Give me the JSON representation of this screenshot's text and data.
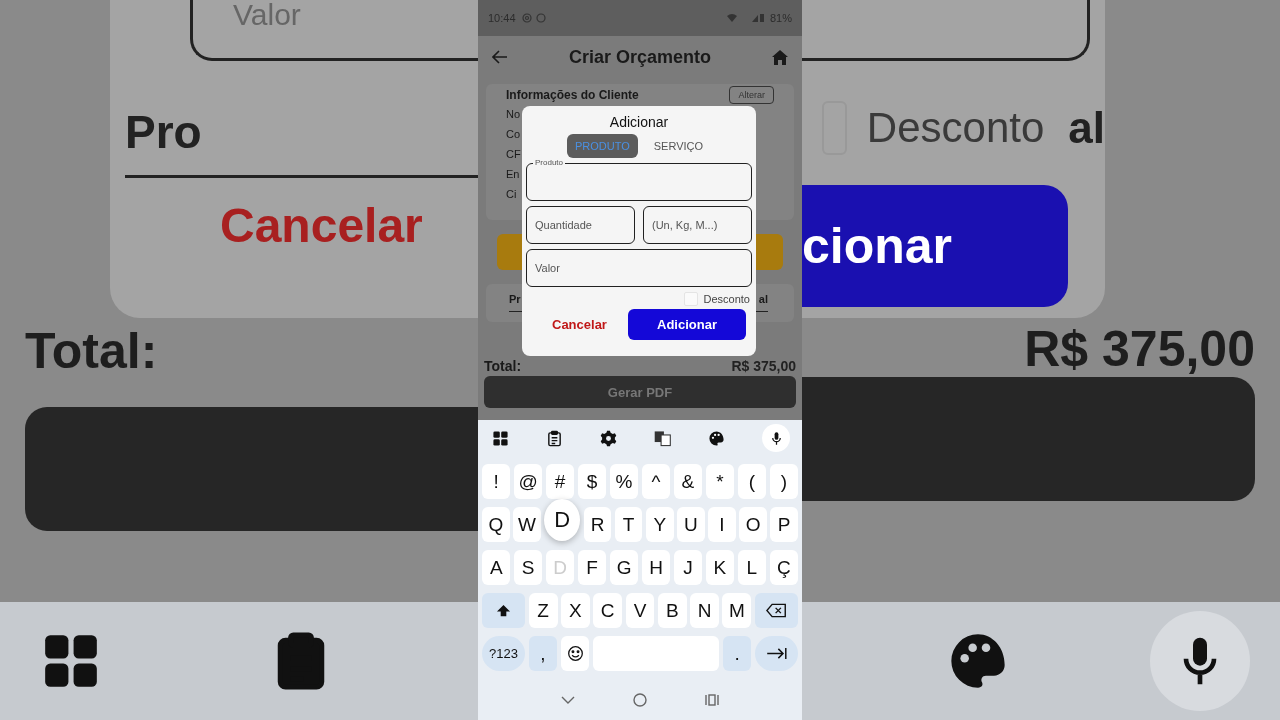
{
  "backdrop": {
    "left": {
      "field_text": "Valor",
      "label": "Pro",
      "cancel": "Cancelar",
      "total_label": "Total:"
    },
    "right": {
      "checkbox_checked": false,
      "checkbox_label": "Desconto",
      "label": "al",
      "button": "cionar",
      "total_value": "R$ 375,00"
    }
  },
  "status_bar": {
    "time": "10:44",
    "battery": "81%"
  },
  "app_bar": {
    "title": "Criar Orçamento"
  },
  "client_card": {
    "title": "Informações do Cliente",
    "edit_button": "Alterar",
    "lines": [
      "No",
      "Co",
      "CF",
      "En",
      "Ci"
    ]
  },
  "products_card": {
    "left": "Pr",
    "right": "al"
  },
  "total": {
    "label": "Total:",
    "value": "R$ 375,00"
  },
  "pdf_button": "Gerar PDF",
  "dialog": {
    "title": "Adicionar",
    "tabs": [
      {
        "label": "PRODUTO",
        "selected": true
      },
      {
        "label": "SERVIÇO",
        "selected": false
      }
    ],
    "fields": [
      {
        "label": "Produto",
        "kind": "floating"
      },
      {
        "placeholder": "Quantidade",
        "kind": "half"
      },
      {
        "placeholder": "(Un, Kg, M...)",
        "kind": "half"
      },
      {
        "placeholder": "Valor",
        "kind": "full"
      }
    ],
    "checkbox": {
      "label": "Desconto",
      "checked": false
    },
    "cancel": "Cancelar",
    "confirm": "Adicionar"
  },
  "keyboard": {
    "rows": [
      [
        {
          "label": "!"
        },
        {
          "label": "@"
        },
        {
          "label": "#"
        },
        {
          "label": "$"
        },
        {
          "label": "%"
        },
        {
          "label": "^"
        },
        {
          "label": "&"
        },
        {
          "label": "*"
        },
        {
          "label": "("
        },
        {
          "label": ")"
        }
      ],
      [
        {
          "label": "Q"
        },
        {
          "label": "W"
        },
        {
          "label": "D",
          "kind": "preview"
        },
        {
          "label": "R"
        },
        {
          "label": "T"
        },
        {
          "label": "Y"
        },
        {
          "label": "U"
        },
        {
          "label": "I"
        },
        {
          "label": "O"
        },
        {
          "label": "P"
        }
      ],
      [
        {
          "label": "A"
        },
        {
          "label": "S"
        },
        {
          "label": "D",
          "kind": "pressed"
        },
        {
          "label": "F"
        },
        {
          "label": "G"
        },
        {
          "label": "H"
        },
        {
          "label": "J"
        },
        {
          "label": "K"
        },
        {
          "label": "L"
        },
        {
          "label": "Ç"
        }
      ],
      [
        {
          "kind": "shift"
        },
        {
          "label": "Z"
        },
        {
          "label": "X"
        },
        {
          "label": "C"
        },
        {
          "label": "V"
        },
        {
          "label": "B"
        },
        {
          "label": "N"
        },
        {
          "label": "M"
        },
        {
          "kind": "backspace"
        }
      ],
      [
        {
          "label": "?123",
          "kind": "mode"
        },
        {
          "label": ",",
          "kind": "func"
        },
        {
          "kind": "emoji"
        },
        {
          "kind": "space"
        },
        {
          "label": ".",
          "kind": "func"
        },
        {
          "kind": "enter"
        }
      ]
    ]
  }
}
